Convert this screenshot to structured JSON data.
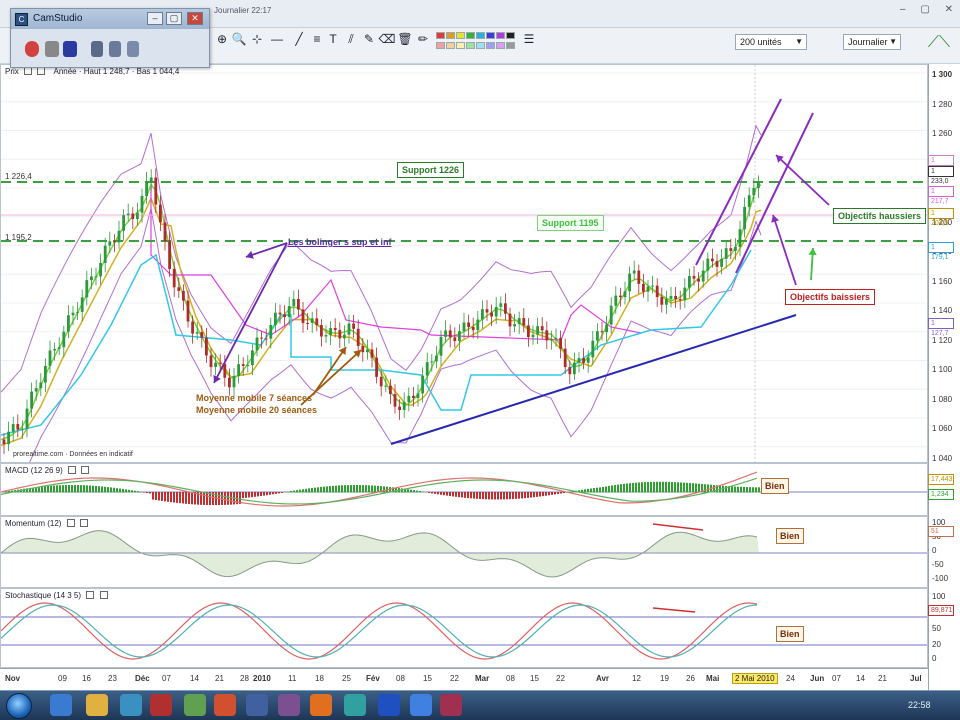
{
  "window": {
    "title": "CamStudio",
    "info_text": "Journalier 22:17"
  },
  "toolbar": {
    "units_select": "200 unités",
    "period_select": "Journalier"
  },
  "price_pane": {
    "label": "Prix",
    "header_info": "Année · Haut 1 248,7 · Bas 1 044,4",
    "level_high_label": "1 226,4",
    "level_low_label": "1 195,2",
    "source_text": "prorealtime.com · Données en indicatif",
    "y_ticks": [
      "1 300",
      "1 280",
      "1 260",
      "1 240",
      "1 220",
      "1 200",
      "1 180",
      "1 160",
      "1 140",
      "1 120",
      "1 100",
      "1 080",
      "1 060",
      "1 040"
    ],
    "price_tags": [
      {
        "value": "1 256,6",
        "color": "#c080c0"
      },
      {
        "value": "1 233,0",
        "color": "#333333"
      },
      {
        "value": "1 217,7",
        "color": "#d060d0"
      },
      {
        "value": "1 204,5",
        "color": "#c09000"
      },
      {
        "value": "1 179,1",
        "color": "#30a0d0"
      },
      {
        "value": "1 127,7",
        "color": "#8060c0"
      }
    ],
    "annotations": {
      "support_1226": "Support 1226",
      "support_1195": "Support 1195",
      "bollinger": "Les bolinger s sup et inf",
      "ma7": "Moyenne mobile 7 séances",
      "ma20": "Moyenne mobile 20 séances",
      "obj_haussiers": "Objectifs haussiers",
      "obj_baissiers": "Objectifs baissiers"
    }
  },
  "macd_pane": {
    "label": "MACD (12 26 9)",
    "tags": [
      "17,443",
      "1,234"
    ],
    "note": "Bien"
  },
  "momentum_pane": {
    "label": "Momentum (12)",
    "y_ticks": [
      "100",
      "50",
      "0",
      "-50",
      "-100"
    ],
    "tag": "51",
    "note": "Bien"
  },
  "stoch_pane": {
    "label": "Stochastique (14 3 5)",
    "y_ticks": [
      "100",
      "80",
      "50",
      "20",
      "0"
    ],
    "tag": "89,871",
    "note": "Bien"
  },
  "x_axis": {
    "ticks": [
      {
        "label": "Nov",
        "month": true
      },
      {
        "label": "09"
      },
      {
        "label": "16"
      },
      {
        "label": "23"
      },
      {
        "label": "Déc",
        "month": true
      },
      {
        "label": "07"
      },
      {
        "label": "14"
      },
      {
        "label": "21"
      },
      {
        "label": "28"
      },
      {
        "label": "2010",
        "month": true
      },
      {
        "label": "11"
      },
      {
        "label": "18"
      },
      {
        "label": "25"
      },
      {
        "label": "Fév",
        "month": true
      },
      {
        "label": "08"
      },
      {
        "label": "15"
      },
      {
        "label": "22"
      },
      {
        "label": "Mar",
        "month": true
      },
      {
        "label": "08"
      },
      {
        "label": "15"
      },
      {
        "label": "22"
      },
      {
        "label": "Avr",
        "month": true
      },
      {
        "label": "12"
      },
      {
        "label": "19"
      },
      {
        "label": "26"
      },
      {
        "label": "Mai",
        "month": true
      },
      {
        "label": "24"
      },
      {
        "label": "Jun",
        "month": true
      },
      {
        "label": "07"
      },
      {
        "label": "14"
      },
      {
        "label": "21"
      },
      {
        "label": "Jul",
        "month": true
      }
    ],
    "current_date": "2 Mai 2010"
  },
  "taskbar": {
    "clock": "22:58"
  },
  "colors": {
    "bollinger": "#b070d0",
    "ma7": "#7ad040",
    "ma20": "#d4b020",
    "sar_pink": "#e040e0",
    "sar_cyan": "#30c8e8",
    "support_line": "#3aa040",
    "trend_line": "#2828b0",
    "candle_up": "#2a9a3a",
    "candle_down": "#b02a2a"
  }
}
